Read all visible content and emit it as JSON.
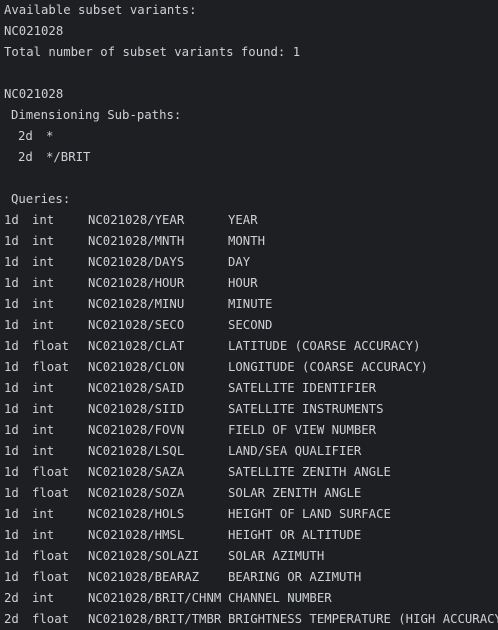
{
  "header": {
    "available_label": "Available subset variants:",
    "variant": "NC021028",
    "total_label": "Total number of subset variants found: 1"
  },
  "subset": {
    "name": "NC021028",
    "dimensioning_label": "Dimensioning Sub-paths:",
    "subpaths": [
      {
        "dim": "2d",
        "path": "*"
      },
      {
        "dim": "2d",
        "path": "*/BRIT"
      }
    ]
  },
  "queries": {
    "label": "Queries:",
    "rows": [
      {
        "dim": "1d",
        "type": "int",
        "path": "NC021028/YEAR",
        "desc": "YEAR"
      },
      {
        "dim": "1d",
        "type": "int",
        "path": "NC021028/MNTH",
        "desc": "MONTH"
      },
      {
        "dim": "1d",
        "type": "int",
        "path": "NC021028/DAYS",
        "desc": "DAY"
      },
      {
        "dim": "1d",
        "type": "int",
        "path": "NC021028/HOUR",
        "desc": "HOUR"
      },
      {
        "dim": "1d",
        "type": "int",
        "path": "NC021028/MINU",
        "desc": "MINUTE"
      },
      {
        "dim": "1d",
        "type": "int",
        "path": "NC021028/SECO",
        "desc": "SECOND"
      },
      {
        "dim": "1d",
        "type": "float",
        "path": "NC021028/CLAT",
        "desc": "LATITUDE (COARSE ACCURACY)"
      },
      {
        "dim": "1d",
        "type": "float",
        "path": "NC021028/CLON",
        "desc": "LONGITUDE (COARSE ACCURACY)"
      },
      {
        "dim": "1d",
        "type": "int",
        "path": "NC021028/SAID",
        "desc": "SATELLITE IDENTIFIER"
      },
      {
        "dim": "1d",
        "type": "int",
        "path": "NC021028/SIID",
        "desc": "SATELLITE INSTRUMENTS"
      },
      {
        "dim": "1d",
        "type": "int",
        "path": "NC021028/FOVN",
        "desc": "FIELD OF VIEW NUMBER"
      },
      {
        "dim": "1d",
        "type": "int",
        "path": "NC021028/LSQL",
        "desc": "LAND/SEA QUALIFIER"
      },
      {
        "dim": "1d",
        "type": "float",
        "path": "NC021028/SAZA",
        "desc": "SATELLITE ZENITH ANGLE"
      },
      {
        "dim": "1d",
        "type": "float",
        "path": "NC021028/SOZA",
        "desc": "SOLAR ZENITH ANGLE"
      },
      {
        "dim": "1d",
        "type": "int",
        "path": "NC021028/HOLS",
        "desc": "HEIGHT OF LAND SURFACE"
      },
      {
        "dim": "1d",
        "type": "int",
        "path": "NC021028/HMSL",
        "desc": "HEIGHT OR ALTITUDE"
      },
      {
        "dim": "1d",
        "type": "float",
        "path": "NC021028/SOLAZI",
        "desc": "SOLAR AZIMUTH"
      },
      {
        "dim": "1d",
        "type": "float",
        "path": "NC021028/BEARAZ",
        "desc": "BEARING OR AZIMUTH"
      },
      {
        "dim": "2d",
        "type": "int",
        "path": "NC021028/BRIT/CHNM",
        "desc": "CHANNEL NUMBER"
      },
      {
        "dim": "2d",
        "type": "float",
        "path": "NC021028/BRIT/TMBR",
        "desc": "BRIGHTNESS TEMPERATURE (HIGH ACCURACY)"
      }
    ]
  },
  "colors": {
    "background": "#1e1f22",
    "text": "#cdd1d6"
  }
}
